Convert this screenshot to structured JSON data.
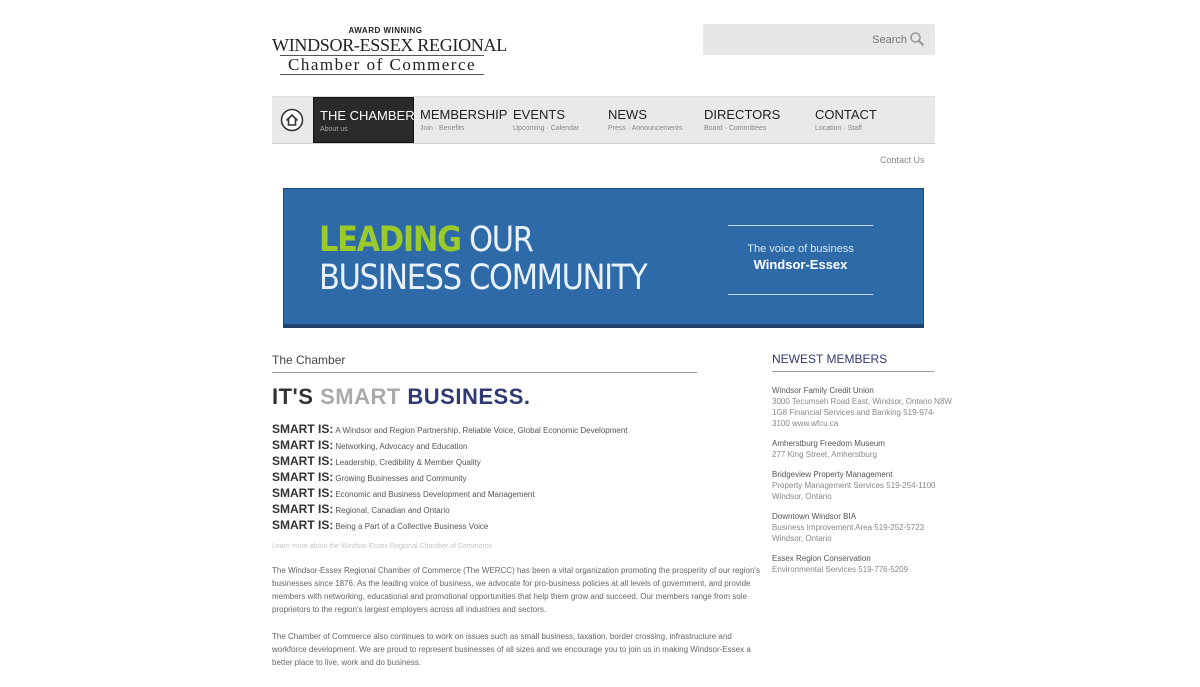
{
  "logo": {
    "award": "AWARD WINNING",
    "name": "WINDSOR-ESSEX REGIONAL",
    "sub": "Chamber of Commerce"
  },
  "search": {
    "placeholder": "Search"
  },
  "nav": {
    "items": [
      {
        "label": "THE CHAMBER",
        "sub": "About us"
      },
      {
        "label": "MEMBERSHIP",
        "sub": "Join · Benefits"
      },
      {
        "label": "EVENTS",
        "sub": "Upcoming · Calendar"
      },
      {
        "label": "NEWS",
        "sub": "Press · Announcements"
      },
      {
        "label": "DIRECTORS",
        "sub": "Board · Committees"
      },
      {
        "label": "CONTACT",
        "sub": "Location · Staff"
      }
    ]
  },
  "top_link": "Contact Us",
  "banner": {
    "leading": "LEADING",
    "our": " OUR",
    "line2": "BUSINESS COMMUNITY",
    "side_a": "The voice of business",
    "side_b": "Windsor-Essex"
  },
  "main": {
    "section_title": "The Chamber",
    "headline_its": "IT'S ",
    "headline_smart": "SMART",
    "headline_business": " BUSINESS.",
    "smart_items": [
      {
        "k": "SMART IS:",
        "v": "A Windsor and Region Partnership, Reliable Voice, Global Economic Development"
      },
      {
        "k": "SMART IS:",
        "v": "Networking, Advocacy and Education"
      },
      {
        "k": "SMART IS:",
        "v": "Leadership, Credibility & Member Quality"
      },
      {
        "k": "SMART IS:",
        "v": "Growing Businesses and Community"
      },
      {
        "k": "SMART IS:",
        "v": "Economic and Business Development and Management"
      },
      {
        "k": "SMART IS:",
        "v": "Regional, Canadian and Ontario"
      },
      {
        "k": "SMART IS:",
        "v": "Being a Part of a Collective Business Voice"
      }
    ],
    "note": "Learn more about the Windsor-Essex Regional Chamber of Commerce",
    "p1": "The Windsor-Essex Regional Chamber of Commerce (The WERCC) has been a vital organization promoting the prosperity of our region's businesses since 1876. As the leading voice of business, we advocate for pro-business policies at all levels of government, and provide members with networking, educational and promotional opportunities that help them grow and succeed. Our members range from sole proprietors to the region's largest employers across all industries and sectors.",
    "p2": "The Chamber of Commerce also continues to work on issues such as small business, taxation, border crossing, infrastructure and workforce development. We are proud to represent businesses of all sizes and we encourage you to join us in making Windsor-Essex a better place to live, work and do business."
  },
  "sidebar": {
    "title": "NEWEST MEMBERS",
    "members": [
      {
        "name": "Windsor Family Credit Union",
        "info": "3000 Tecumseh Road East, Windsor, Ontario N8W 1G8 Financial Services and Banking 519-974-3100 www.wfcu.ca"
      },
      {
        "name": "Amherstburg Freedom Museum",
        "info": "277 King Street, Amherstburg"
      },
      {
        "name": "Bridgeview Property Management",
        "info": "Property Management Services 519-254-1100 Windsor, Ontario"
      },
      {
        "name": "Downtown Windsor BIA",
        "info": "Business Improvement Area 519-252-5723 Windsor, Ontario"
      },
      {
        "name": "Essex Region Conservation",
        "info": "Environmental Services 519-776-5209"
      }
    ]
  }
}
